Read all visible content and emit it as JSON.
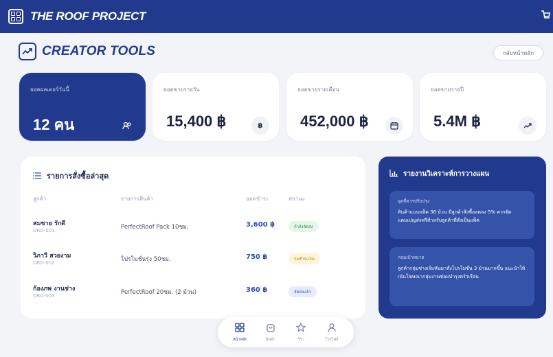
{
  "header": {
    "brand": "THE ROOF PROJECT",
    "logo_icon": "grid-logo-icon",
    "cart_icon": "cart-icon"
  },
  "page": {
    "title": "CREATOR TOOLS",
    "home_button": "กลับหน้าหลัก"
  },
  "stats": [
    {
      "label": "ยอดผลเตอร์วันนี้",
      "value": "12 คน",
      "icon": "users-icon"
    },
    {
      "label": "ยอดขายรายวัน",
      "value": "15,400 ฿",
      "icon": "baht-icon",
      "icon_text": "฿"
    },
    {
      "label": "ยอดขายรายเดือน",
      "value": "452,000 ฿",
      "icon": "calendar-icon"
    },
    {
      "label": "ยอดขายรายปี",
      "value": "5.4M ฿",
      "icon": "trend-up-icon"
    }
  ],
  "orders": {
    "title": "รายการสั่งซื้อล่าสุด",
    "columns": [
      "ลูกค้า",
      "รายการสินค้า",
      "ยอดชำระ",
      "สถานะ"
    ],
    "rows": [
      {
        "name": "สมชาย รักดี",
        "id": "ORD-001",
        "product": "PerfectRoof Pack 10ชม.",
        "amount": "3,600 ฿",
        "status": "กำลังจัดส่ง"
      },
      {
        "name": "วิภาวี สวยงาม",
        "id": "ORD-002",
        "product": "โปรโมชั่นรุ่ง 50ชม.",
        "amount": "750 ฿",
        "status": "รอชำระเงิน"
      },
      {
        "name": "ก้องภพ งานช่าง",
        "id": "ORD-003",
        "product": "PerfectRoof 20ชม. (2 ม้วน)",
        "amount": "360 ฿",
        "status": "จัดส่งแล้ว"
      }
    ]
  },
  "analysis": {
    "title": "รายงานวิเคราะห์การวางแผน",
    "cards": [
      {
        "title": "จุดที่ควรปรับปรุง",
        "body": "สินค้าแบบแพ็ค 36 ม้วน มีลูกค้าสั่งซื้อลดลง 5% ควรจัดแคมเปญส่งฟรีสำหรับลูกค้าที่สั่งเป็นแพ็ค"
      },
      {
        "title": "กลุ่มเป้าหมาย",
        "body": "ลูกค้ากลุ่มช่างเริ่มหันมาสั่งโปรโมชั่น 3 ม้วนมากขึ้น แนะนำให้เน้นโฆษณากลุ่มงานซ่อมบำรุงครัวเรือน"
      }
    ]
  },
  "nav": [
    {
      "label": "หน้าหลัก",
      "icon": "home-grid-icon"
    },
    {
      "label": "สินค้า",
      "icon": "bag-icon"
    },
    {
      "label": "รีวิว",
      "icon": "star-icon"
    },
    {
      "label": "โปรไฟล์",
      "icon": "profile-icon"
    }
  ],
  "colors": {
    "primary": "#213a8e",
    "accent": "#2f4fc0",
    "background": "#f3f4f8"
  }
}
